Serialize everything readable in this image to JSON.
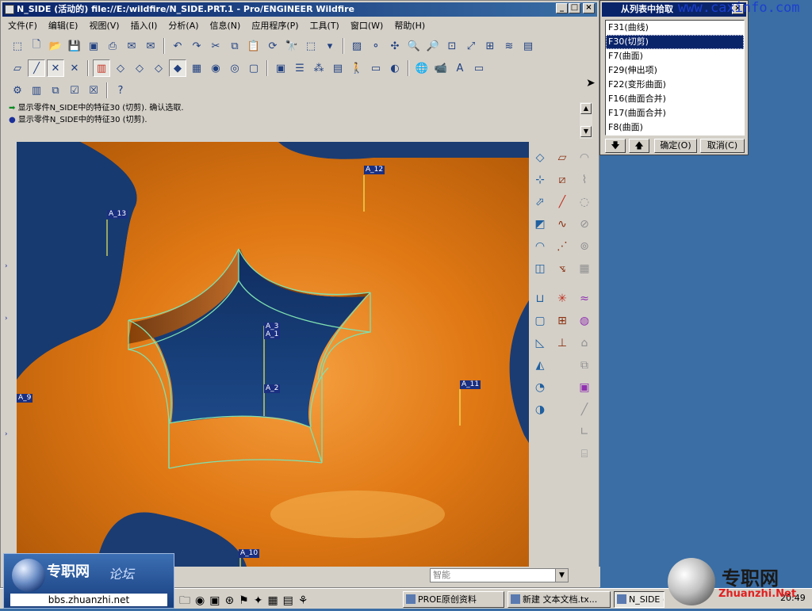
{
  "window": {
    "title": "N_SIDE (活动的) file://E:/wildfire/N_SIDE.PRT.1 - Pro/ENGINEER Wildfire"
  },
  "menu": [
    "文件(F)",
    "编辑(E)",
    "视图(V)",
    "插入(I)",
    "分析(A)",
    "信息(N)",
    "应用程序(P)",
    "工具(T)",
    "窗口(W)",
    "帮助(H)"
  ],
  "messages": [
    "显示零件N_SIDE中的特征30 (切剪). 确认选取.",
    "显示零件N_SIDE中的特征30 (切剪)."
  ],
  "datum_labels": [
    "A_12",
    "A_13",
    "A_3",
    "A_1",
    "A_2",
    "A_11",
    "A_9",
    "A_10"
  ],
  "status": {
    "filter_value": "智能"
  },
  "pick_dialog": {
    "title": "从列表中拾取",
    "items": [
      "F31(曲线)",
      "F30(切剪)",
      "F7(曲面)",
      "F29(伸出项)",
      "F22(变形曲面)",
      "F16(曲面合并)",
      "F17(曲面合并)",
      "F8(曲面)"
    ],
    "selected_index": 1,
    "ok_label": "确定(O)",
    "cancel_label": "取消(C)"
  },
  "taskbar": {
    "tasks": [
      "PROE原创资料",
      "新建 文本文档.tx...",
      "N_SIDE (活动..."
    ],
    "clock": "20:49"
  },
  "watermarks": {
    "site": "www.caxinfo.com",
    "logo_title": "专职网",
    "logo_sub": "论坛",
    "logo_url": "bbs.zhuanzhi.net",
    "right_cn": "专职网",
    "right_en": "Zhuanzhi.Net"
  },
  "colors": {
    "model_orange": "#e07814",
    "background_blue": "#1b3c72",
    "edge_cyan": "#7fe0b0",
    "title_bar": "#0a246a"
  }
}
